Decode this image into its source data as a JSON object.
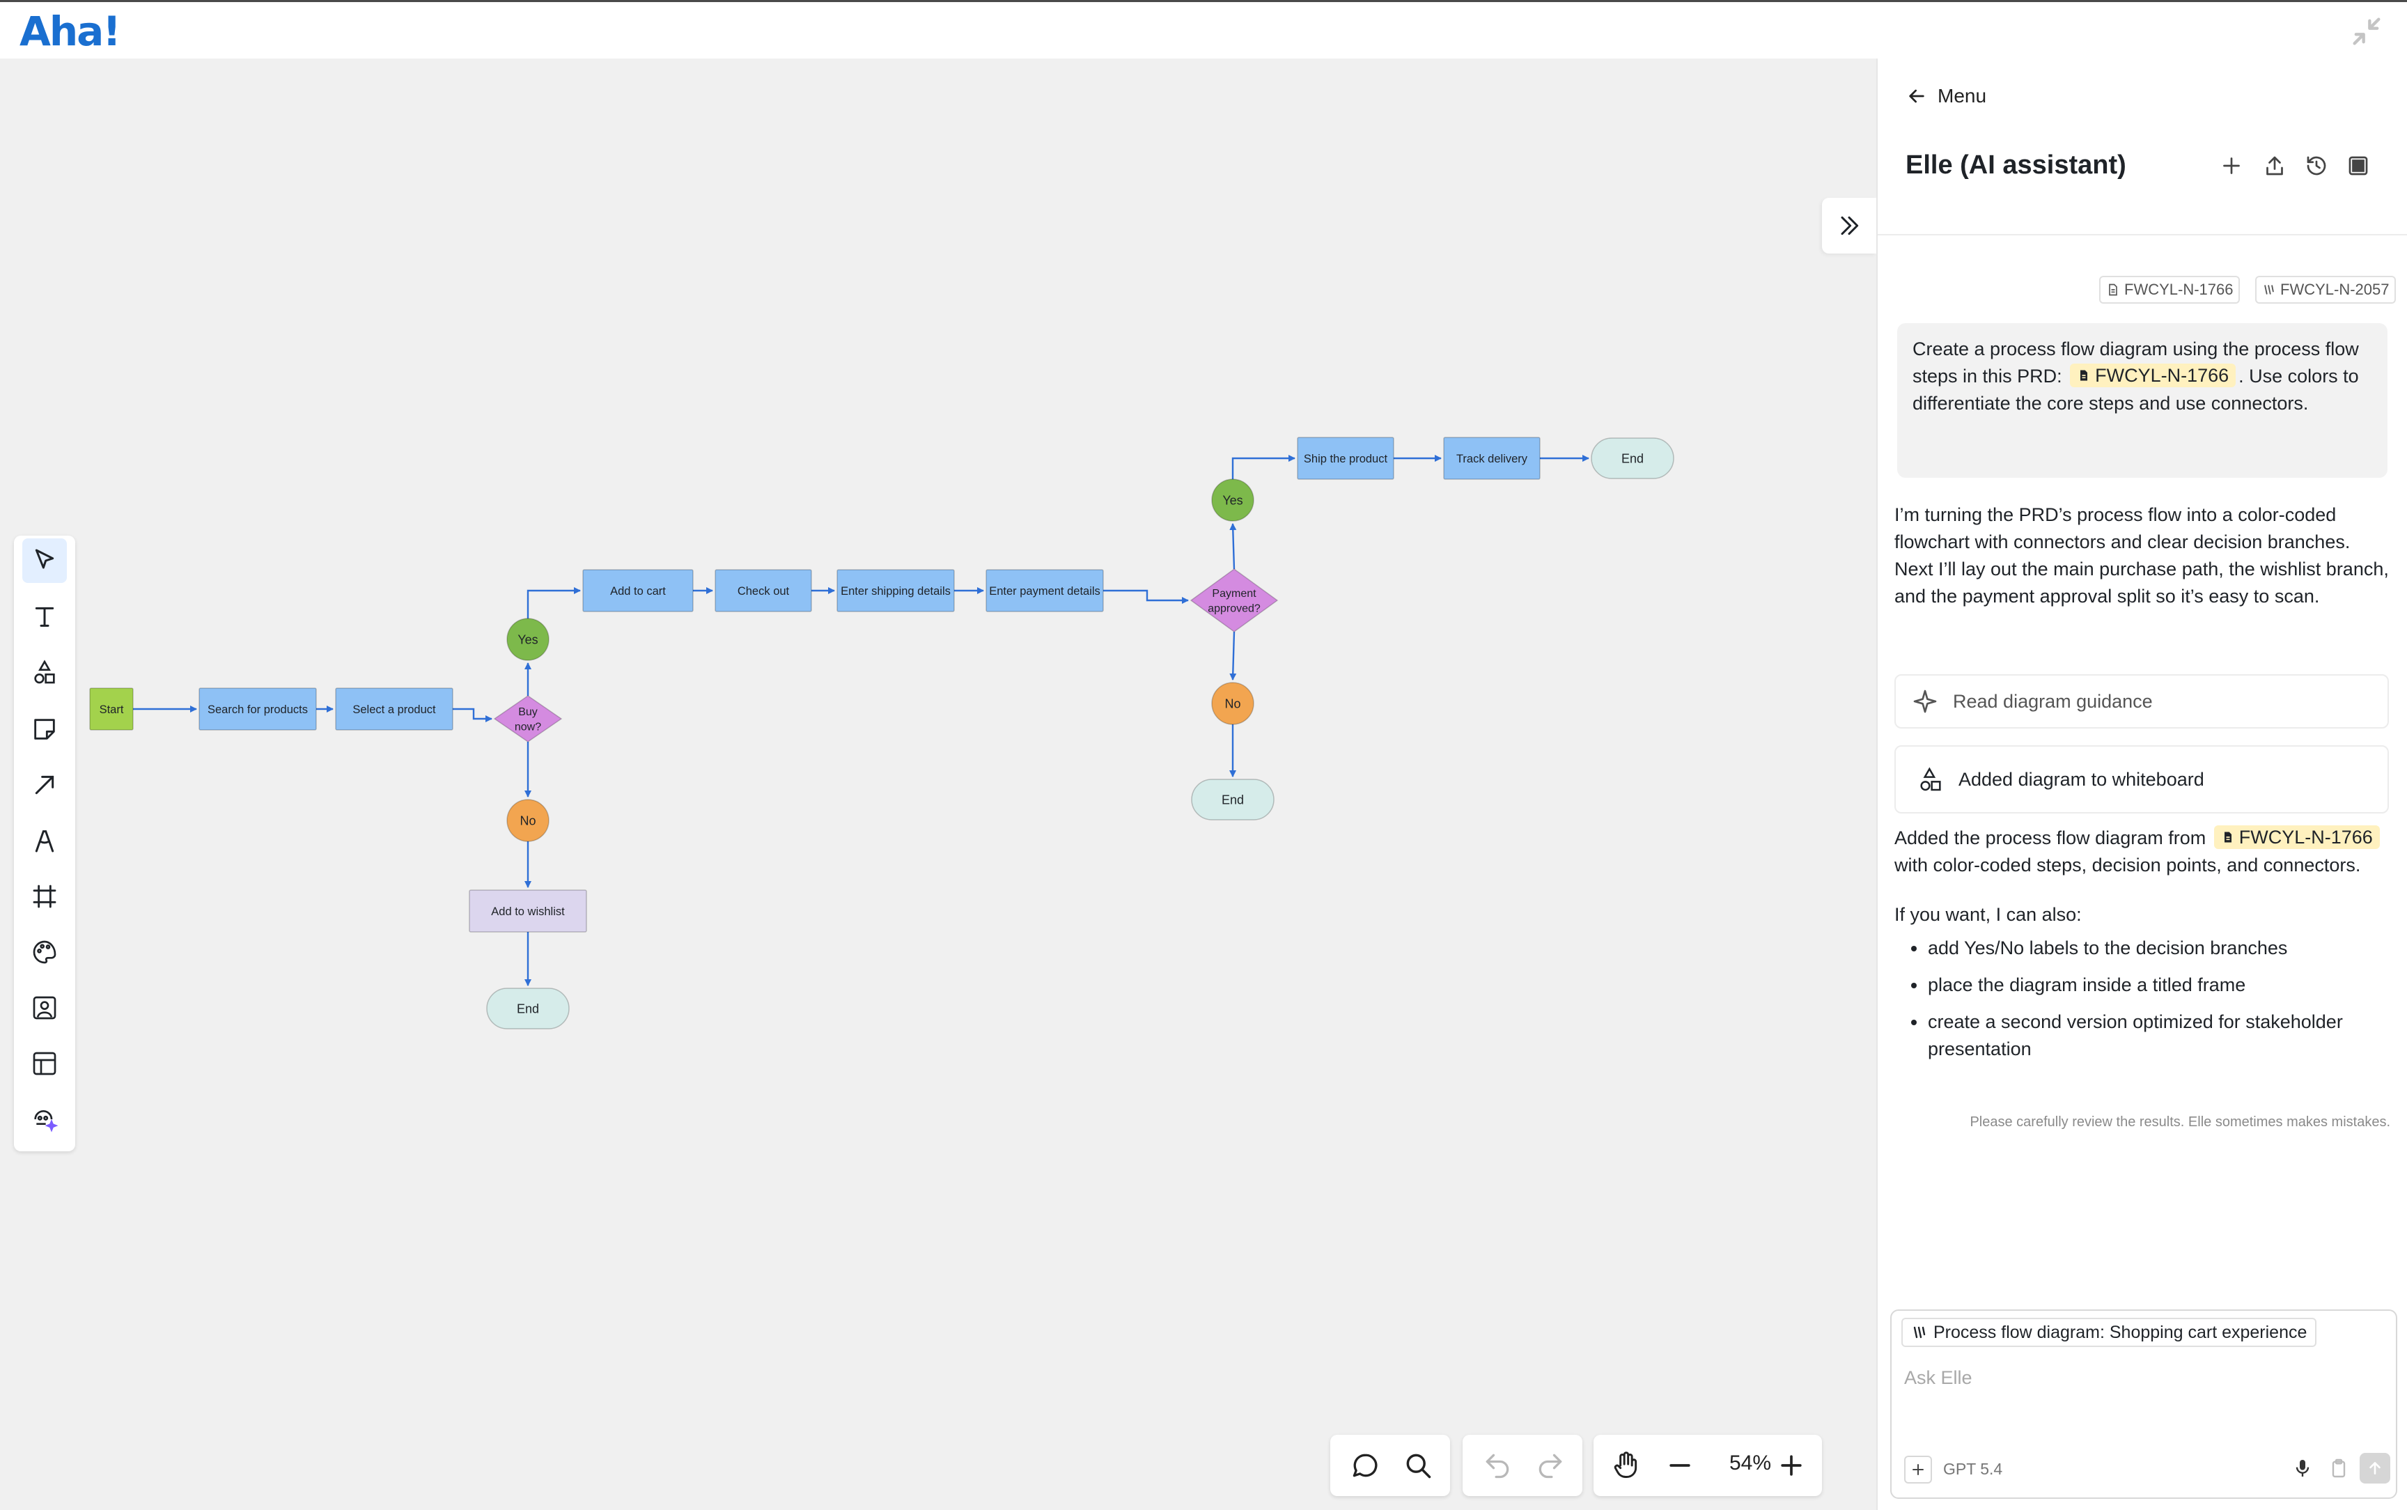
{
  "app": {
    "logo": "Aha!"
  },
  "diagram": {
    "nodes": [
      {
        "id": "start",
        "label": "Start",
        "shape": "rect",
        "color": "#a3d24c",
        "lines": [
          "Start"
        ]
      },
      {
        "id": "search",
        "label": "Search for products",
        "shape": "rect",
        "color": "#8ec1f5",
        "lines": [
          "Search for products"
        ]
      },
      {
        "id": "select",
        "label": "Select a product",
        "shape": "rect",
        "color": "#8ec1f5",
        "lines": [
          "Select a product"
        ]
      },
      {
        "id": "buy",
        "label": "Buy now?",
        "shape": "diamond",
        "color": "#d48be0",
        "lines": [
          "Buy",
          "now?"
        ]
      },
      {
        "id": "yes1",
        "label": "Yes",
        "shape": "circle",
        "color": "#7db94b",
        "lines": [
          "Yes"
        ]
      },
      {
        "id": "no1",
        "label": "No",
        "shape": "circle",
        "color": "#f2a550",
        "lines": [
          "No"
        ]
      },
      {
        "id": "wishlist",
        "label": "Add to wishlist",
        "shape": "rect",
        "color": "#dcd6ee",
        "lines": [
          "Add to wishlist"
        ]
      },
      {
        "id": "end1",
        "label": "End",
        "shape": "pill",
        "color": "#d6ecea",
        "lines": [
          "End"
        ]
      },
      {
        "id": "cart",
        "label": "Add to cart",
        "shape": "rect",
        "color": "#8ec1f5",
        "lines": [
          "Add to cart"
        ]
      },
      {
        "id": "checkout",
        "label": "Check out",
        "shape": "rect",
        "color": "#8ec1f5",
        "lines": [
          "Check out"
        ]
      },
      {
        "id": "shipping",
        "label": "Enter shipping details",
        "shape": "rect",
        "color": "#8ec1f5",
        "lines": [
          "Enter shipping details"
        ]
      },
      {
        "id": "payment",
        "label": "Enter payment details",
        "shape": "rect",
        "color": "#8ec1f5",
        "lines": [
          "Enter payment details"
        ]
      },
      {
        "id": "approved",
        "label": "Payment approved?",
        "shape": "diamond",
        "color": "#d48be0",
        "lines": [
          "Payment",
          "approved?"
        ]
      },
      {
        "id": "yes2",
        "label": "Yes",
        "shape": "circle",
        "color": "#7db94b",
        "lines": [
          "Yes"
        ]
      },
      {
        "id": "no2",
        "label": "No",
        "shape": "circle",
        "color": "#f2a550",
        "lines": [
          "No"
        ]
      },
      {
        "id": "end2",
        "label": "End",
        "shape": "pill",
        "color": "#d6ecea",
        "lines": [
          "End"
        ]
      },
      {
        "id": "ship",
        "label": "Ship the product",
        "shape": "rect",
        "color": "#8ec1f5",
        "lines": [
          "Ship the product"
        ]
      },
      {
        "id": "track",
        "label": "Track delivery",
        "shape": "rect",
        "color": "#8ec1f5",
        "lines": [
          "Track delivery"
        ]
      },
      {
        "id": "end3",
        "label": "End",
        "shape": "pill",
        "color": "#d6ecea",
        "lines": [
          "End"
        ]
      }
    ],
    "edges": [
      [
        "start",
        "search"
      ],
      [
        "search",
        "select"
      ],
      [
        "select",
        "buy"
      ],
      [
        "buy",
        "yes1"
      ],
      [
        "buy",
        "no1"
      ],
      [
        "no1",
        "wishlist"
      ],
      [
        "wishlist",
        "end1"
      ],
      [
        "yes1",
        "cart"
      ],
      [
        "cart",
        "checkout"
      ],
      [
        "checkout",
        "shipping"
      ],
      [
        "shipping",
        "payment"
      ],
      [
        "payment",
        "approved"
      ],
      [
        "approved",
        "yes2"
      ],
      [
        "approved",
        "no2"
      ],
      [
        "no2",
        "end2"
      ],
      [
        "yes2",
        "ship"
      ],
      [
        "ship",
        "track"
      ],
      [
        "track",
        "end3"
      ]
    ],
    "connector_color": "#2f6fd6"
  },
  "left_toolbar": {
    "tools": [
      {
        "name": "select-tool",
        "icon": "cursor-icon",
        "active": true
      },
      {
        "name": "text-tool",
        "icon": "text-icon"
      },
      {
        "name": "shapes-tool",
        "icon": "shapes-icon"
      },
      {
        "name": "sticky-note-tool",
        "icon": "sticky-note-icon"
      },
      {
        "name": "connector-tool",
        "icon": "arrow-icon"
      },
      {
        "name": "pen-tool",
        "icon": "pen-icon"
      },
      {
        "name": "frame-tool",
        "icon": "frame-icon"
      },
      {
        "name": "palette-tool",
        "icon": "palette-icon"
      },
      {
        "name": "image-tool",
        "icon": "image-icon"
      },
      {
        "name": "template-tool",
        "icon": "template-icon"
      },
      {
        "name": "ai-tool",
        "icon": "ai-sparkle-icon"
      }
    ]
  },
  "bottom_toolbar": {
    "zoom": "54%"
  },
  "panel": {
    "menu_label": "Menu",
    "title": "Elle (AI assistant)",
    "refs": [
      "FWCYL-N-1766",
      "FWCYL-N-2057"
    ],
    "user_message": {
      "before": "Create a process flow diagram using the process flow steps in this PRD:",
      "ref": "FWCYL-N-1766",
      "after": ". Use colors to differentiate the core steps and use connectors."
    },
    "ai_message_1": "I’m turning the PRD’s process flow into a color-coded flowchart with connectors and clear decision branches. Next I’ll lay out the main purchase path, the wishlist branch, and the payment approval split so it’s easy to scan.",
    "action_guidance": "Read diagram guidance",
    "action_added": "Added diagram to whiteboard",
    "ai_message_2": {
      "before": "Added the process flow diagram from",
      "ref": "FWCYL-N-1766",
      "after": "with color-coded steps, decision points, and connectors."
    },
    "ai_message_3": "If you want, I can also:",
    "suggestions": [
      "add Yes/No labels to the decision branches",
      "place the diagram inside a titled frame",
      "create a second version optimized for stakeholder presentation"
    ],
    "disclaimer": "Please carefully review the results. Elle sometimes makes mistakes.",
    "input": {
      "context_chip": "Process flow diagram: Shopping cart experience",
      "placeholder": "Ask Elle",
      "value": "",
      "model": "GPT 5.4"
    }
  }
}
